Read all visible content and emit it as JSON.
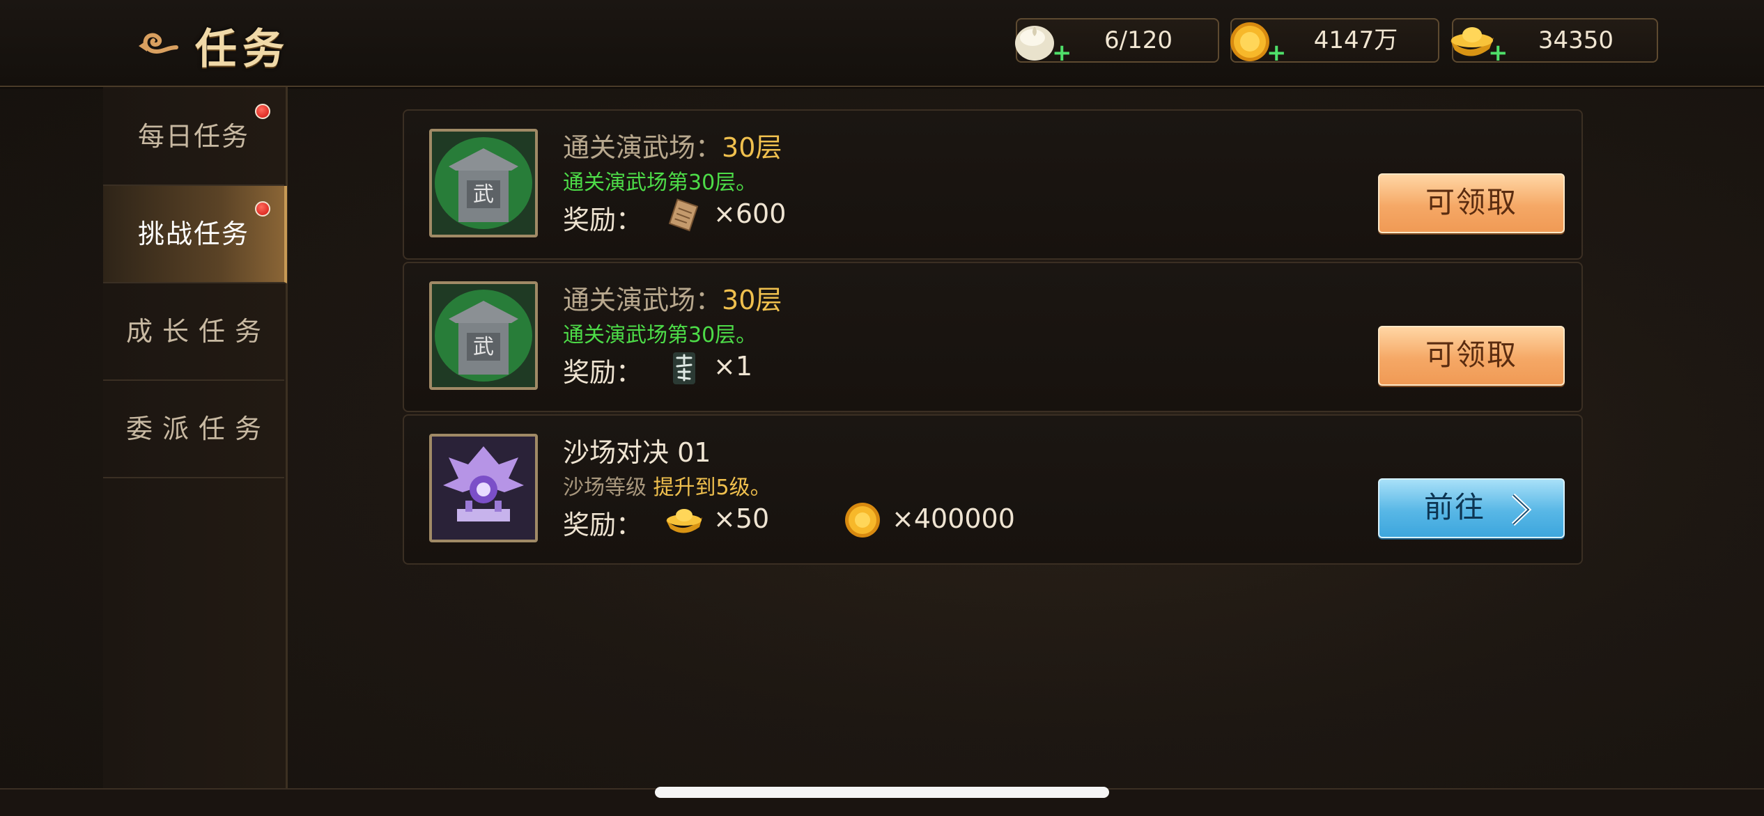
{
  "header": {
    "title": "任务",
    "resources": [
      {
        "name": "stamina",
        "icon": "steamed-bun-icon",
        "value": "6/120"
      },
      {
        "name": "coins",
        "icon": "gold-coin-icon",
        "value": "4147万"
      },
      {
        "name": "ingots",
        "icon": "gold-ingot-icon",
        "value": "34350"
      }
    ],
    "plus": "+"
  },
  "sidebar": {
    "tabs": [
      {
        "label": "每日任务",
        "badge": true,
        "active": false
      },
      {
        "label": "挑战任务",
        "badge": true,
        "active": true
      },
      {
        "label": "成长任务",
        "badge": false,
        "active": false
      },
      {
        "label": "委派任务",
        "badge": false,
        "active": false
      }
    ]
  },
  "tasks": [
    {
      "icon": "martial-arena-icon",
      "title": "通关演武场：",
      "title_value": "30层",
      "desc": "通关演武场第30层。",
      "reward_label": "奖励：",
      "rewards": [
        {
          "icon": "scroll-fragment-icon",
          "qty": "×600"
        }
      ],
      "button": "可领取",
      "button_style": "orange"
    },
    {
      "icon": "martial-arena-icon",
      "title": "通关演武场：",
      "title_value": "30层",
      "desc": "通关演武场第30层。",
      "reward_label": "奖励：",
      "rewards": [
        {
          "icon": "calligraphy-token-icon",
          "qty": "×1"
        }
      ],
      "button": "可领取",
      "button_style": "orange"
    },
    {
      "icon": "battlefield-emblem-icon",
      "title": "沙场对决 01",
      "desc_prefix": "沙场等级",
      "desc_value": "提升到5级。",
      "reward_label": "奖励：",
      "rewards": [
        {
          "icon": "gold-ingot-icon",
          "qty": "×50"
        },
        {
          "icon": "gold-coin-icon",
          "qty": "×400000"
        }
      ],
      "button": "前往",
      "button_style": "blue"
    }
  ],
  "colors": {
    "accent_gold": "#f0c04e",
    "desc_green": "#4ddc48",
    "badge_red": "#d2140f"
  }
}
